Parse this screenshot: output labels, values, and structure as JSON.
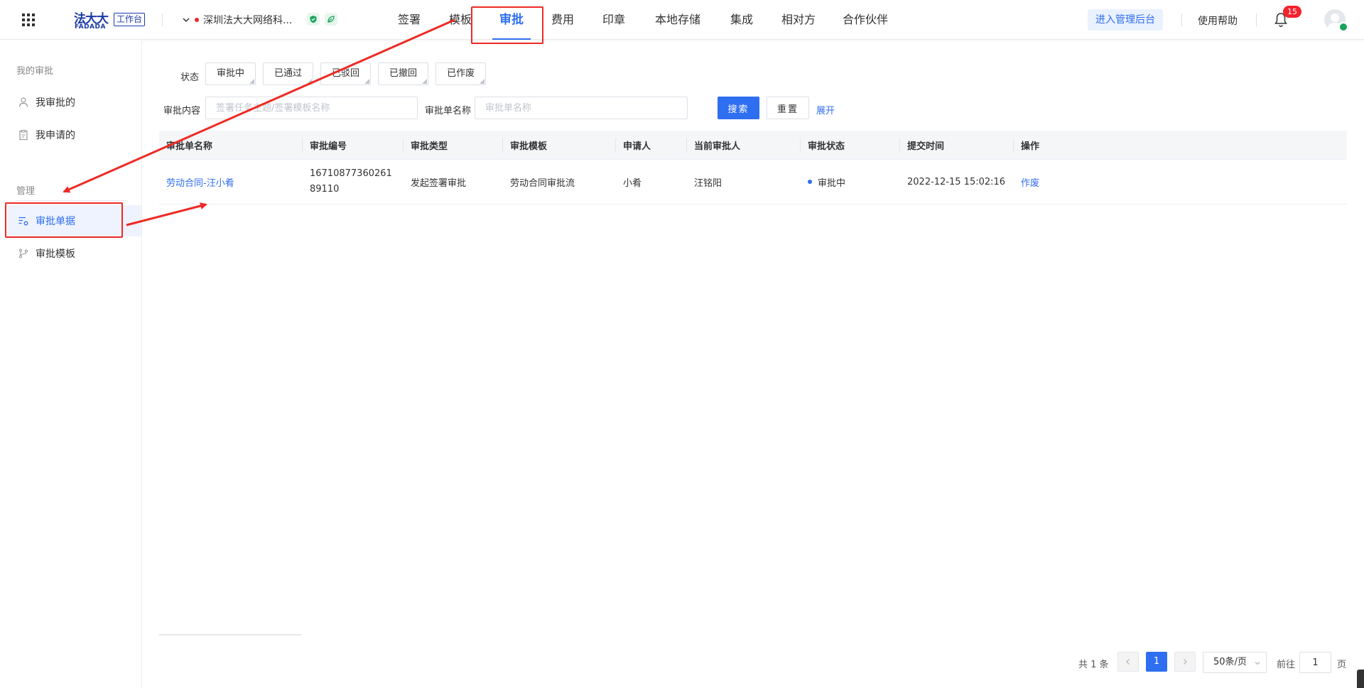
{
  "header": {
    "logo_cn": "法大大",
    "logo_en": "FADADA",
    "workbench_label": "工作台",
    "company_name": "深圳法大大网络科...",
    "nav": [
      "签署",
      "模板",
      "审批",
      "费用",
      "印章",
      "本地存储",
      "集成",
      "相对方",
      "合作伙伴"
    ],
    "active_nav": "审批",
    "admin_button": "进入管理后台",
    "help": "使用帮助",
    "notification_count": "15"
  },
  "sidebar": {
    "group_mine": "我的审批",
    "items_mine": [
      "我审批的",
      "我申请的"
    ],
    "group_manage": "管理",
    "items_manage": [
      "审批单据",
      "审批模板"
    ],
    "active_item": "审批单据"
  },
  "filters": {
    "status_label": "状态",
    "status_options": [
      "审批中",
      "已通过",
      "已驳回",
      "已撤回",
      "已作废"
    ],
    "content_label": "审批内容",
    "content_placeholder": "签署任务主题/签署模板名称",
    "name_label": "审批单名称",
    "name_placeholder": "审批单名称",
    "search_button": "搜索",
    "reset_button": "重置",
    "expand_link": "展开"
  },
  "table": {
    "columns": [
      "审批单名称",
      "审批编号",
      "审批类型",
      "审批模板",
      "申请人",
      "当前审批人",
      "审批状态",
      "提交时间",
      "操作"
    ],
    "rows": [
      {
        "name": "劳动合同-汪小肴",
        "number": "1671087736026189110",
        "type": "发起签署审批",
        "template": "劳动合同审批流",
        "applicant": "小肴",
        "approver": "汪铭阳",
        "status": "审批中",
        "submit_time": "2022-12-15 15:02:16",
        "action": "作废"
      }
    ]
  },
  "pagination": {
    "total": "共 1 条",
    "current_page": "1",
    "page_size": "50条/页",
    "goto_label": "前往",
    "goto_value": "1",
    "page_suffix": "页"
  },
  "colors": {
    "primary": "#2e6ef0",
    "annotation": "#ee2a24",
    "badge": "#f5222d"
  }
}
